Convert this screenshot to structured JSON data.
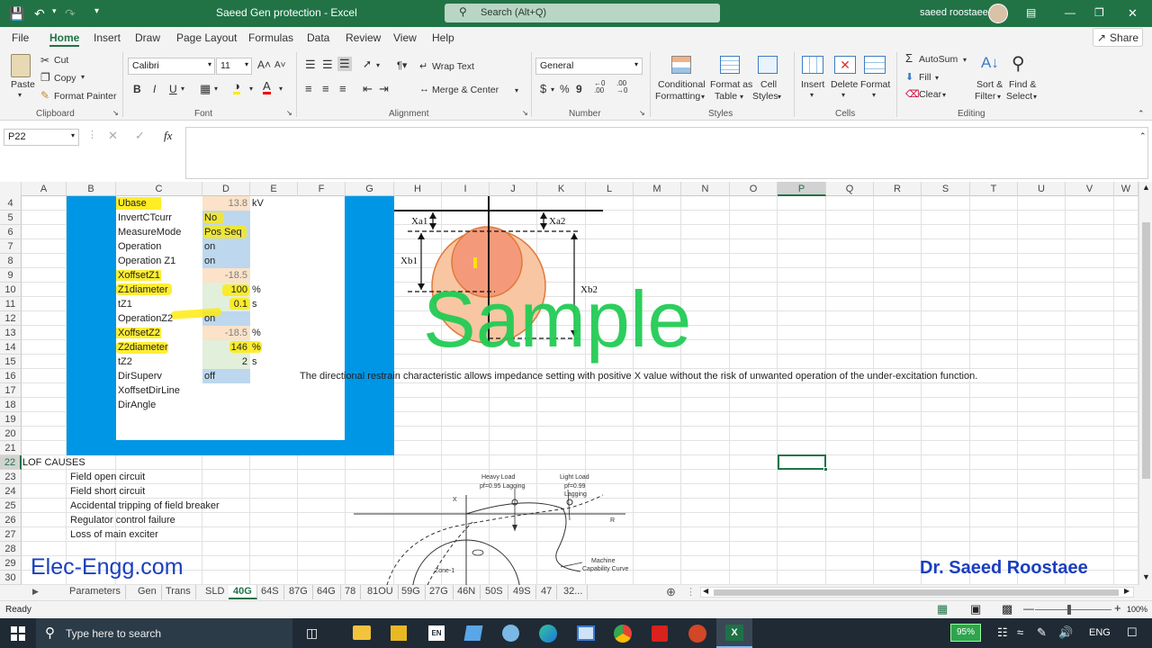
{
  "window": {
    "title": "Saeed Gen protection  -  Excel",
    "search_placeholder": "Search (Alt+Q)",
    "user": "saeed roostaee"
  },
  "menu": {
    "tabs": [
      "File",
      "Home",
      "Insert",
      "Draw",
      "Page Layout",
      "Formulas",
      "Data",
      "Review",
      "View",
      "Help"
    ],
    "active": "Home",
    "share": "Share"
  },
  "ribbon": {
    "clipboard": {
      "paste": "Paste",
      "cut": "Cut",
      "copy": "Copy",
      "format_painter": "Format Painter",
      "label": "Clipboard"
    },
    "font": {
      "name": "Calibri",
      "size": "11",
      "label": "Font",
      "bold": "B",
      "italic": "I",
      "underline": "U"
    },
    "alignment": {
      "wrap": "Wrap Text",
      "merge": "Merge & Center",
      "label": "Alignment"
    },
    "number": {
      "format": "General",
      "currency": "$",
      "percent": "%",
      "comma": "9",
      "label": "Number"
    },
    "styles": {
      "conditional": "Conditional",
      "formatting": "Formatting",
      "format_as": "Format as",
      "table": "Table",
      "cell": "Cell",
      "cell_styles": "Styles",
      "label": "Styles"
    },
    "cells": {
      "insert": "Insert",
      "delete": "Delete",
      "format": "Format",
      "label": "Cells"
    },
    "editing": {
      "autosum": "AutoSum",
      "fill": "Fill",
      "clear": "Clear",
      "sort": "Sort &",
      "filter": "Filter",
      "find": "Find &",
      "select": "Select",
      "label": "Editing"
    }
  },
  "formula_bar": {
    "name_box": "P22",
    "fx": "fx",
    "value": ""
  },
  "columns": [
    "A",
    "B",
    "C",
    "D",
    "E",
    "F",
    "G",
    "H",
    "I",
    "J",
    "K",
    "L",
    "M",
    "N",
    "O",
    "P",
    "Q",
    "R",
    "S",
    "T",
    "U",
    "V",
    "W"
  ],
  "rows": [
    "4",
    "5",
    "6",
    "7",
    "8",
    "9",
    "10",
    "11",
    "12",
    "13",
    "14",
    "15",
    "16",
    "17",
    "18",
    "19",
    "20",
    "21",
    "22",
    "23",
    "24",
    "25",
    "26",
    "27",
    "28",
    "29",
    "30"
  ],
  "params": [
    {
      "name": "Ubase",
      "value": "13.8",
      "unit": "kV"
    },
    {
      "name": "InvertCTcurr",
      "value": "No",
      "unit": ""
    },
    {
      "name": "MeasureMode",
      "value": "Pos Seq",
      "unit": ""
    },
    {
      "name": "Operation",
      "value": "on",
      "unit": ""
    },
    {
      "name": "Operation Z1",
      "value": "on",
      "unit": ""
    },
    {
      "name": "XoffsetZ1",
      "value": "-18.5",
      "unit": ""
    },
    {
      "name": "Z1diameter",
      "value": "100",
      "unit": "%"
    },
    {
      "name": "tZ1",
      "value": "0.1",
      "unit": "s"
    },
    {
      "name": "OperationZ2",
      "value": "on",
      "unit": ""
    },
    {
      "name": "XoffsetZ2",
      "value": "-18.5",
      "unit": "%"
    },
    {
      "name": "Z2diameter",
      "value": "146",
      "unit": "%"
    },
    {
      "name": "tZ2",
      "value": "2",
      "unit": "s"
    },
    {
      "name": "DirSuperv",
      "value": "off",
      "unit": ""
    },
    {
      "name": "XoffsetDirLine",
      "value": "",
      "unit": ""
    },
    {
      "name": "DirAngle",
      "value": "",
      "unit": ""
    }
  ],
  "note": "The directional restrain characteristic allows impedance setting with positive X value without the risk of unwanted operation of the under-excitation function.",
  "lof": {
    "title": "LOF CAUSES",
    "causes": [
      "Field open circuit",
      "Field short circuit",
      "Accidental tripping of field breaker",
      "Regulator control failure",
      "Loss of main exciter"
    ]
  },
  "diagram1": {
    "xa1": "Xa1",
    "xa2": "Xa2",
    "xb1": "Xb1",
    "xb2": "Xb2",
    "watermark": "Sample"
  },
  "diagram2": {
    "heavy": "Heavy Load",
    "heavy_pf": "pf=0.95 Lagging",
    "light": "Light Load",
    "light_pf": "pf=0.99",
    "light_lag": "Lagging",
    "x": "X",
    "r": "R",
    "machine": "Machine",
    "capability": "Capability Curve",
    "zone": "Zone-1"
  },
  "branding": {
    "left": "Elec-Engg.com",
    "right": "Dr. Saeed Roostaee"
  },
  "sheets": [
    "Parameters",
    "Gen",
    "Trans",
    "SLD",
    "40G",
    "64S",
    "87G",
    "64G",
    "78",
    "81OU",
    "59G",
    "27G",
    "46N",
    "50S",
    "49S",
    "47",
    "32..."
  ],
  "active_sheet": "40G",
  "status": {
    "ready": "Ready",
    "zoom": "100%"
  },
  "taskbar": {
    "search": "Type here to search",
    "battery": "95%",
    "lang": "ENG"
  },
  "colors": {
    "excel_green": "#217346",
    "blue_fill": "#0096e6",
    "yellow": "#ffea00",
    "light_blue": "#bdd7ee",
    "peach": "#fbe2c8",
    "watermark": "#22cc55",
    "brand_blue": "#1a3fbf"
  }
}
